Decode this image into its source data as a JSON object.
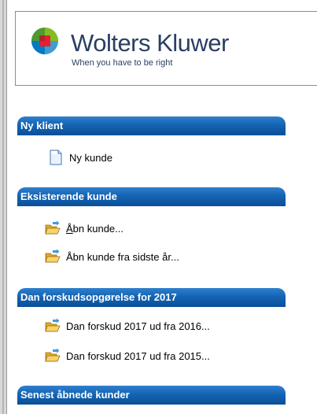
{
  "logo": {
    "name": "Wolters Kluwer",
    "tagline": "When you have to be right",
    "brand_colors": [
      "#85bc20",
      "#e5202e",
      "#007ac3",
      "#409bd2"
    ]
  },
  "sections": [
    {
      "header": "Ny klient",
      "items": [
        {
          "label": "Ny kunde",
          "icon": "blank-document-icon"
        }
      ]
    },
    {
      "header": "Eksisterende kunde",
      "items": [
        {
          "label_underlined_char": "Å",
          "label_rest": "bn kunde...",
          "icon": "open-folder-icon"
        },
        {
          "label": "Åbn kunde fra sidste år...",
          "icon": "open-folder-icon"
        }
      ]
    },
    {
      "header": "Dan forskudsopgørelse for 2017",
      "items": [
        {
          "label": "Dan forskud 2017 ud fra 2016...",
          "icon": "open-folder-icon"
        },
        {
          "label": "Dan forskud 2017 ud fra 2015...",
          "icon": "open-folder-icon"
        }
      ]
    },
    {
      "header": "Senest åbnede kunder",
      "items": []
    }
  ],
  "colors": {
    "header_blue": "#1464b4",
    "logo_text": "#2a3f63"
  }
}
